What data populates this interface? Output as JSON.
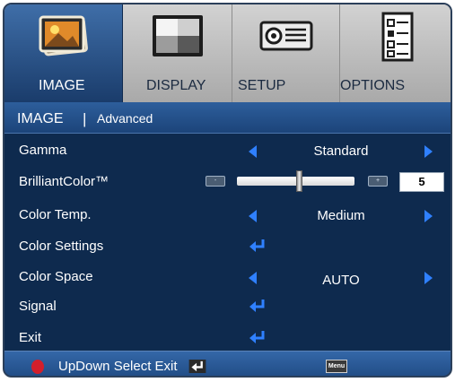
{
  "tabs": [
    {
      "label": "IMAGE",
      "icon": "picture-frame-icon",
      "active": true
    },
    {
      "label": "DISPLAY",
      "icon": "display-screen-icon",
      "active": false
    },
    {
      "label": "SETUP",
      "icon": "projector-icon",
      "active": false
    },
    {
      "label": "OPTIONS",
      "icon": "checklist-icon",
      "active": false
    }
  ],
  "breadcrumb": {
    "main": "IMAGE",
    "separator": "|",
    "sub": "Advanced"
  },
  "rows": {
    "gamma": {
      "label": "Gamma",
      "value": "Standard"
    },
    "brilliant_color": {
      "label": "BrilliantColor™",
      "value": "5",
      "level_fraction": 0.5,
      "minus_label": "-",
      "plus_label": "+"
    },
    "color_temp": {
      "label": "Color Temp.",
      "value": "Medium"
    },
    "color_settings": {
      "label": "Color Settings"
    },
    "color_space": {
      "label": "Color Space",
      "value": "AUTO"
    },
    "signal": {
      "label": "Signal"
    },
    "exit": {
      "label": "Exit"
    }
  },
  "footer": {
    "hint": "UpDown Select Exit",
    "menu_key": "Menu"
  },
  "colors": {
    "accent_arrow": "#2f80ff",
    "panel_bg": "#0e2a4e",
    "active_tab": "#2a5890",
    "footer_dot": "#d21f2b"
  }
}
